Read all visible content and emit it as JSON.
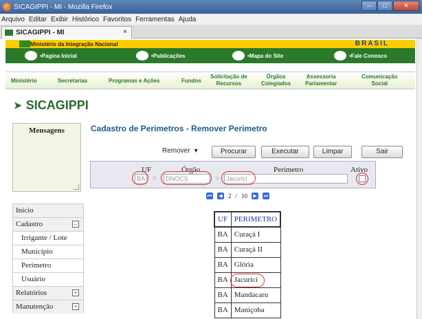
{
  "window": {
    "title": "SICAGIPPI - MI - Mozilla Firefox"
  },
  "menu": [
    "Arquivo",
    "Editar",
    "Exibir",
    "Histórico",
    "Favoritos",
    "Ferramentas",
    "Ajuda"
  ],
  "tab": {
    "label": "SICAGIPPI - MI",
    "close": "×"
  },
  "gov_bar": {
    "ministry": "Ministério da Integração Nacional",
    "brasil": "BRASIL"
  },
  "green_nav": [
    "•Pagina Inicial",
    "•Publicações",
    "•Mapa do Site",
    "•Fale Conosco"
  ],
  "sections": [
    "Ministério",
    "Secretarias",
    "Programas e Ações",
    "Fundos",
    "Solicitação de\nRecursos",
    "Órgãos\nColegiados",
    "Assessoria\nParlamentar",
    "Comunicação\nSocial"
  ],
  "logo": {
    "text": "SICAGIPPI"
  },
  "messages": {
    "title": "Mensagens"
  },
  "page": {
    "title": "Cadastro de Perimetros - Remover Perimetro"
  },
  "toolbar": {
    "mode": "Remover",
    "caret": "▾",
    "procurar": "Procurar",
    "executar": "Executar",
    "limpar": "Limpar",
    "sair": "Sair"
  },
  "form": {
    "uf_label": "UF",
    "orgao_label": "Órgão",
    "perimetro_label": "Perimetro",
    "ativo_label": "Ativo",
    "uf_value": "BA",
    "orgao_value": "DNOCS",
    "perimetro_value": "Jacurici",
    "eq": "="
  },
  "pager": {
    "current": "2",
    "sep": "/",
    "total": "10"
  },
  "sidenav": [
    {
      "label": "Início",
      "sub": false,
      "toggle": ""
    },
    {
      "label": "Cadastro",
      "sub": false,
      "toggle": "–"
    },
    {
      "label": "Irrigante / Lote",
      "sub": true,
      "toggle": ""
    },
    {
      "label": "Município",
      "sub": true,
      "toggle": ""
    },
    {
      "label": "Perímetro",
      "sub": true,
      "toggle": ""
    },
    {
      "label": "Usuário",
      "sub": true,
      "toggle": ""
    },
    {
      "label": "Relatórios",
      "sub": false,
      "toggle": "+"
    },
    {
      "label": "Manutenção",
      "sub": false,
      "toggle": "+"
    }
  ],
  "table": {
    "headers": [
      "UF",
      "PERIMETRO"
    ],
    "rows": [
      [
        "BA",
        "Curaçá I"
      ],
      [
        "BA",
        "Curaçá II"
      ],
      [
        "BA",
        "Glória"
      ],
      [
        "BA",
        "Jacurici"
      ],
      [
        "BA",
        "Mandacaru"
      ],
      [
        "BA",
        "Maniçoba"
      ]
    ]
  }
}
